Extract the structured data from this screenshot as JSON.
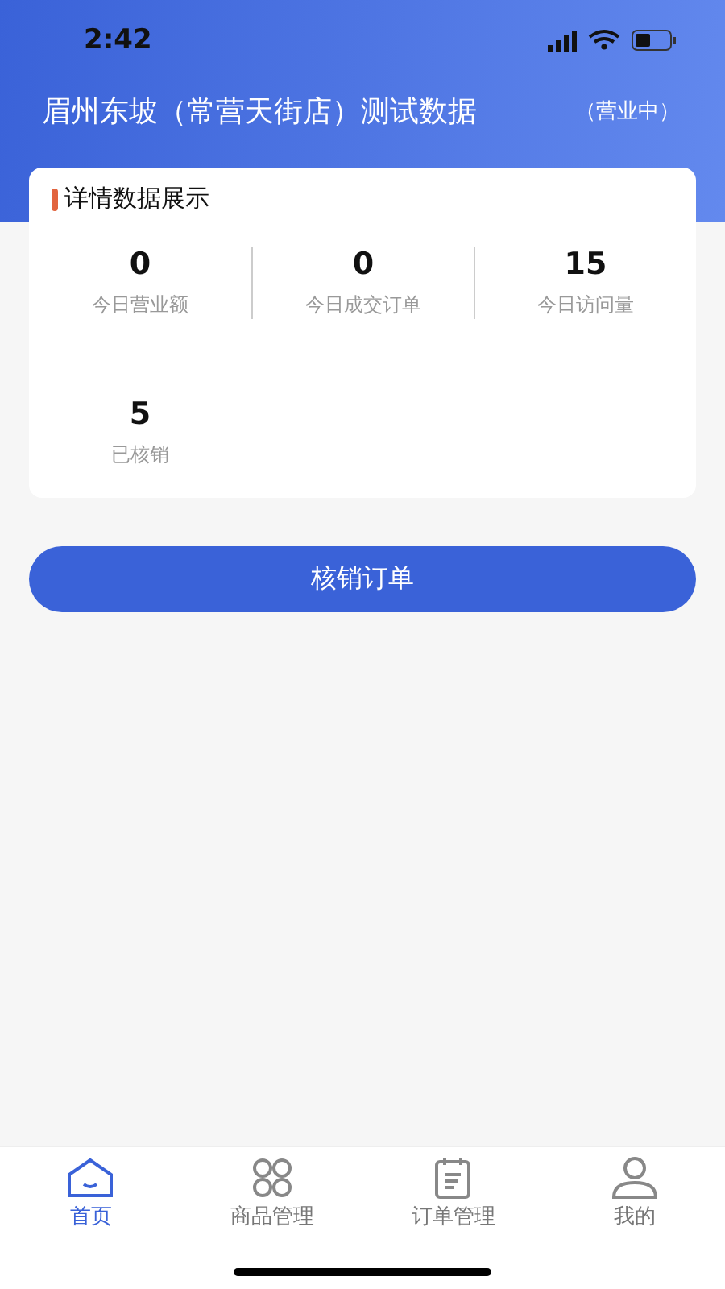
{
  "status_bar": {
    "time": "2:42"
  },
  "header": {
    "title": "眉州东坡（常营天街店）测试数据",
    "status": "（营业中）"
  },
  "card": {
    "title": "详情数据展示",
    "stats": [
      {
        "value": "0",
        "label": "今日营业额"
      },
      {
        "value": "0",
        "label": "今日成交订单"
      },
      {
        "value": "15",
        "label": "今日访问量"
      },
      {
        "value": "5",
        "label": "已核销"
      }
    ]
  },
  "action_button": "核销订单",
  "tab_bar": [
    {
      "kind": "home",
      "label": "首页",
      "selected": true
    },
    {
      "kind": "goods",
      "label": "商品管理",
      "selected": false
    },
    {
      "kind": "orders",
      "label": "订单管理",
      "selected": false
    },
    {
      "kind": "profile",
      "label": "我的",
      "selected": false
    }
  ]
}
